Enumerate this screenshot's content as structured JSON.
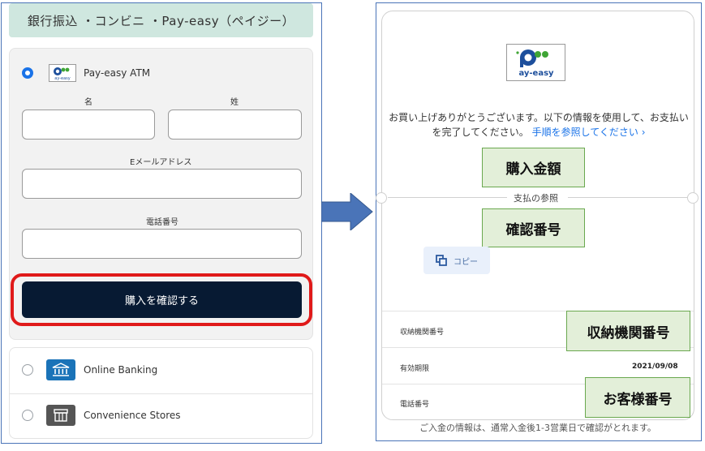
{
  "left": {
    "banner": "銀行振込 ・コンビニ ・Pay-easy（ペイジー）",
    "payeasy_option": {
      "label": "Pay-easy ATM",
      "selected": true
    },
    "form": {
      "first_name_label": "名",
      "last_name_label": "姓",
      "email_label": "Eメールアドレス",
      "phone_label": "電話番号",
      "first_name_value": "",
      "last_name_value": "",
      "email_value": "",
      "phone_value": ""
    },
    "confirm_button": "購入を確認する",
    "methods": [
      {
        "label": "Online Banking",
        "icon": "bank-icon",
        "color": "#1a73b8"
      },
      {
        "label": "Convenience Stores",
        "icon": "store-icon",
        "color": "#555555"
      }
    ]
  },
  "right": {
    "logo_text": "ay-easy",
    "thanks_text": "お買い上げありがとうございます。以下の情報を使用して、お支払いを完了してください。",
    "steps_link": "手順を参照してください ›",
    "callout_amount": "購入金額",
    "reference_label": "支払の参照",
    "callout_confirmation": "確認番号",
    "copy_label": "コピー",
    "rows": [
      {
        "label": "収納機関番号",
        "value": ""
      },
      {
        "label": "有効期限",
        "value": "2021/09/08"
      },
      {
        "label": "電話番号",
        "value": ""
      }
    ],
    "callout_institution": "収納機関番号",
    "callout_customer": "お客様番号",
    "footnote": "ご入金の情報は、通常入金後1-3営業日で確認がとれます。"
  },
  "colors": {
    "accent": "#1a73e8",
    "confirm_bg": "#071a33",
    "highlight_border": "#e01a1a",
    "callout_bg": "#e3efd9",
    "arrow": "#4a74b8"
  }
}
